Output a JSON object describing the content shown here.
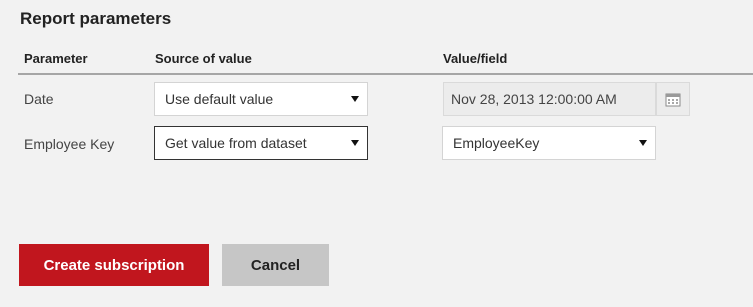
{
  "section": {
    "title": "Report parameters"
  },
  "columns": {
    "parameter": "Parameter",
    "source": "Source of value",
    "value": "Value/field"
  },
  "rows": [
    {
      "label": "Date",
      "source": "Use default value",
      "value": "Nov 28, 2013 12:00:00 AM",
      "value_icon": "calendar-icon"
    },
    {
      "label": "Employee Key",
      "source": "Get value from dataset",
      "value": "EmployeeKey"
    }
  ],
  "buttons": {
    "create": "Create subscription",
    "cancel": "Cancel"
  },
  "colors": {
    "primary": "#c1161e",
    "secondary": "#c6c6c6",
    "background": "#f2f2f2"
  }
}
